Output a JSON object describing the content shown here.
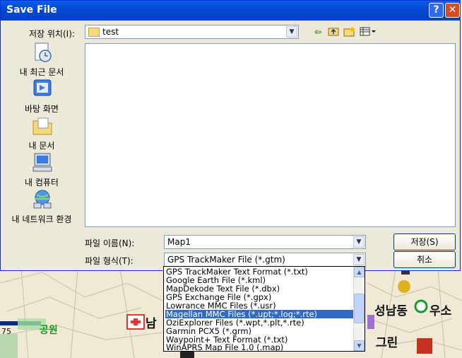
{
  "dialog": {
    "title": "Save File",
    "save_in_label": "저장 위치(I):",
    "save_in_value": "test",
    "filename_label": "파일 이름(N):",
    "filename_value": "Map1",
    "filetype_label": "파일 형식(T):",
    "filetype_value": "GPS TrackMaker File (*.gtm)",
    "save_button": "저장(S)",
    "cancel_button": "취소"
  },
  "places": [
    {
      "label": "내 최근 문서",
      "icon": "recent-documents-icon"
    },
    {
      "label": "바탕 화면",
      "icon": "desktop-icon"
    },
    {
      "label": "내 문서",
      "icon": "my-documents-icon"
    },
    {
      "label": "내 컴퓨터",
      "icon": "my-computer-icon"
    },
    {
      "label": "내 네트워크 환경",
      "icon": "my-network-icon"
    }
  ],
  "filetype_options": [
    "GPS TrackMaker Text Format (*.txt)",
    "Google Earth File (*.kml)",
    "MapDekode Text File (*.dbx)",
    "GPS Exchange File (*.gpx)",
    "Lowrance MMC Files (*.usr)",
    "Magellan MMC Files (*.upt;*.log;*.rte)",
    "OziExplorer Files (*.wpt,*.plt,*.rte)",
    "Garmin PCX5 (*.grm)",
    "Waypoint+ Text Format (*.txt)",
    "WinAPRS Map File 1.0 (.map)"
  ],
  "selected_option_index": 5,
  "map": {
    "labels": [
      "남",
      "성남동",
      "우소",
      "그린",
      "공원",
      "75"
    ]
  },
  "colors": {
    "titlebar": "#0548d1",
    "selection": "#316ac5",
    "map_green": "#1a9a2a"
  }
}
